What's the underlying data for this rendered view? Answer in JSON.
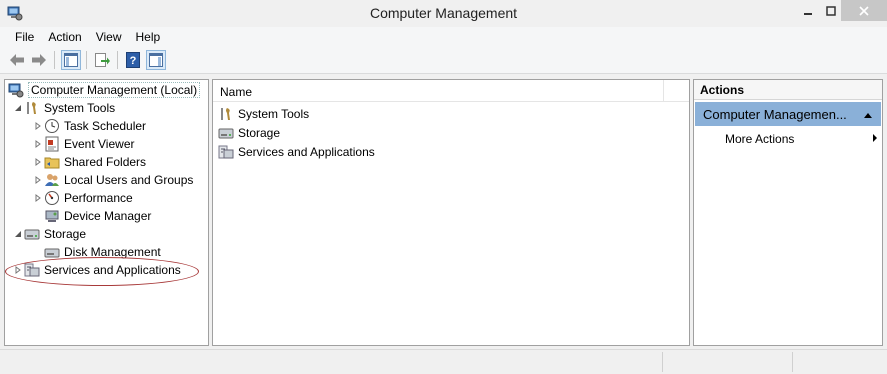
{
  "window": {
    "title": "Computer Management",
    "app_icon": "computer-management-icon",
    "controls": [
      "minimize-icon",
      "maximize-icon",
      "close-icon"
    ]
  },
  "menu": {
    "items": [
      {
        "label": "File"
      },
      {
        "label": "Action"
      },
      {
        "label": "View"
      },
      {
        "label": "Help"
      }
    ]
  },
  "toolbar": {
    "buttons": [
      "back-arrow-icon",
      "forward-arrow-icon",
      "show-hide-console-tree-icon",
      "export-list-icon",
      "help-icon",
      "show-hide-action-pane-icon"
    ]
  },
  "tree": {
    "root": "Computer Management (Local)",
    "items": [
      {
        "label": "System Tools",
        "icon": "system-tools-icon"
      },
      {
        "label": "Task Scheduler",
        "icon": "clock-icon"
      },
      {
        "label": "Event Viewer",
        "icon": "event-viewer-icon"
      },
      {
        "label": "Shared Folders",
        "icon": "shared-folders-icon"
      },
      {
        "label": "Local Users and Groups",
        "icon": "users-icon"
      },
      {
        "label": "Performance",
        "icon": "performance-icon"
      },
      {
        "label": "Device Manager",
        "icon": "device-manager-icon"
      },
      {
        "label": "Storage",
        "icon": "storage-icon"
      },
      {
        "label": "Disk Management",
        "icon": "disk-management-icon"
      },
      {
        "label": "Services and Applications",
        "icon": "services-icon"
      }
    ]
  },
  "middle": {
    "column_header": "Name",
    "items": [
      {
        "label": "System Tools"
      },
      {
        "label": "Storage"
      },
      {
        "label": "Services and Applications"
      }
    ]
  },
  "actions": {
    "header": "Actions",
    "section": "Computer Managemen...",
    "items": [
      {
        "label": "More Actions"
      }
    ]
  },
  "colors": {
    "section_highlight": "#8ab0d8",
    "annotation": "#a83a3a"
  }
}
